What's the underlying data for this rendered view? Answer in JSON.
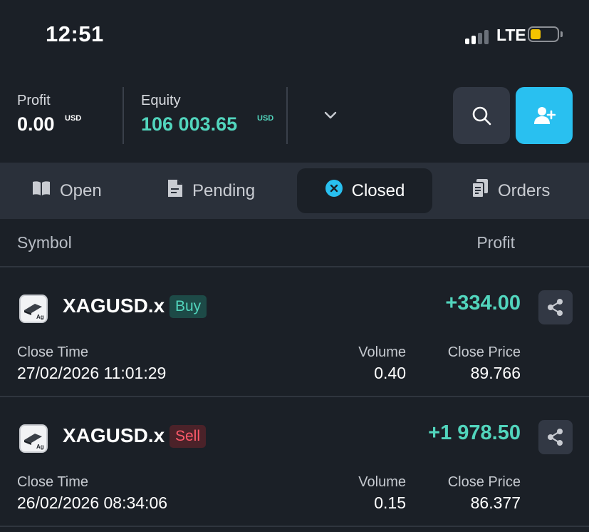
{
  "status_bar": {
    "time": "12:51",
    "network": "LTE",
    "signal_bars": 2,
    "battery_level": 0.25
  },
  "account": {
    "profit_label": "Profit",
    "profit_value": "0.00",
    "profit_currency": "USD",
    "equity_label": "Equity",
    "equity_value": "106 003.65",
    "equity_currency": "USD"
  },
  "colors": {
    "background": "#1b2027",
    "accent_blue": "#29c0f0",
    "positive": "#52d5bd",
    "sell": "#ff5a6a"
  },
  "tabs": [
    {
      "label": "Open",
      "icon": "book-icon",
      "active": false
    },
    {
      "label": "Pending",
      "icon": "document-icon",
      "active": false
    },
    {
      "label": "Closed",
      "icon": "close-circle-icon",
      "active": true
    },
    {
      "label": "Orders",
      "icon": "orders-icon",
      "active": false
    }
  ],
  "table": {
    "symbol_header": "Symbol",
    "profit_header": "Profit",
    "close_time_label": "Close Time",
    "volume_label": "Volume",
    "close_price_label": "Close Price"
  },
  "trades": [
    {
      "symbol": "XAGUSD.x",
      "side": "Buy",
      "profit": "+334.00",
      "close_time": "27/02/2026 11:01:29",
      "volume": "0.40",
      "close_price": "89.766"
    },
    {
      "symbol": "XAGUSD.x",
      "side": "Sell",
      "profit": "+1 978.50",
      "close_time": "26/02/2026 08:34:06",
      "volume": "0.15",
      "close_price": "86.377"
    }
  ]
}
